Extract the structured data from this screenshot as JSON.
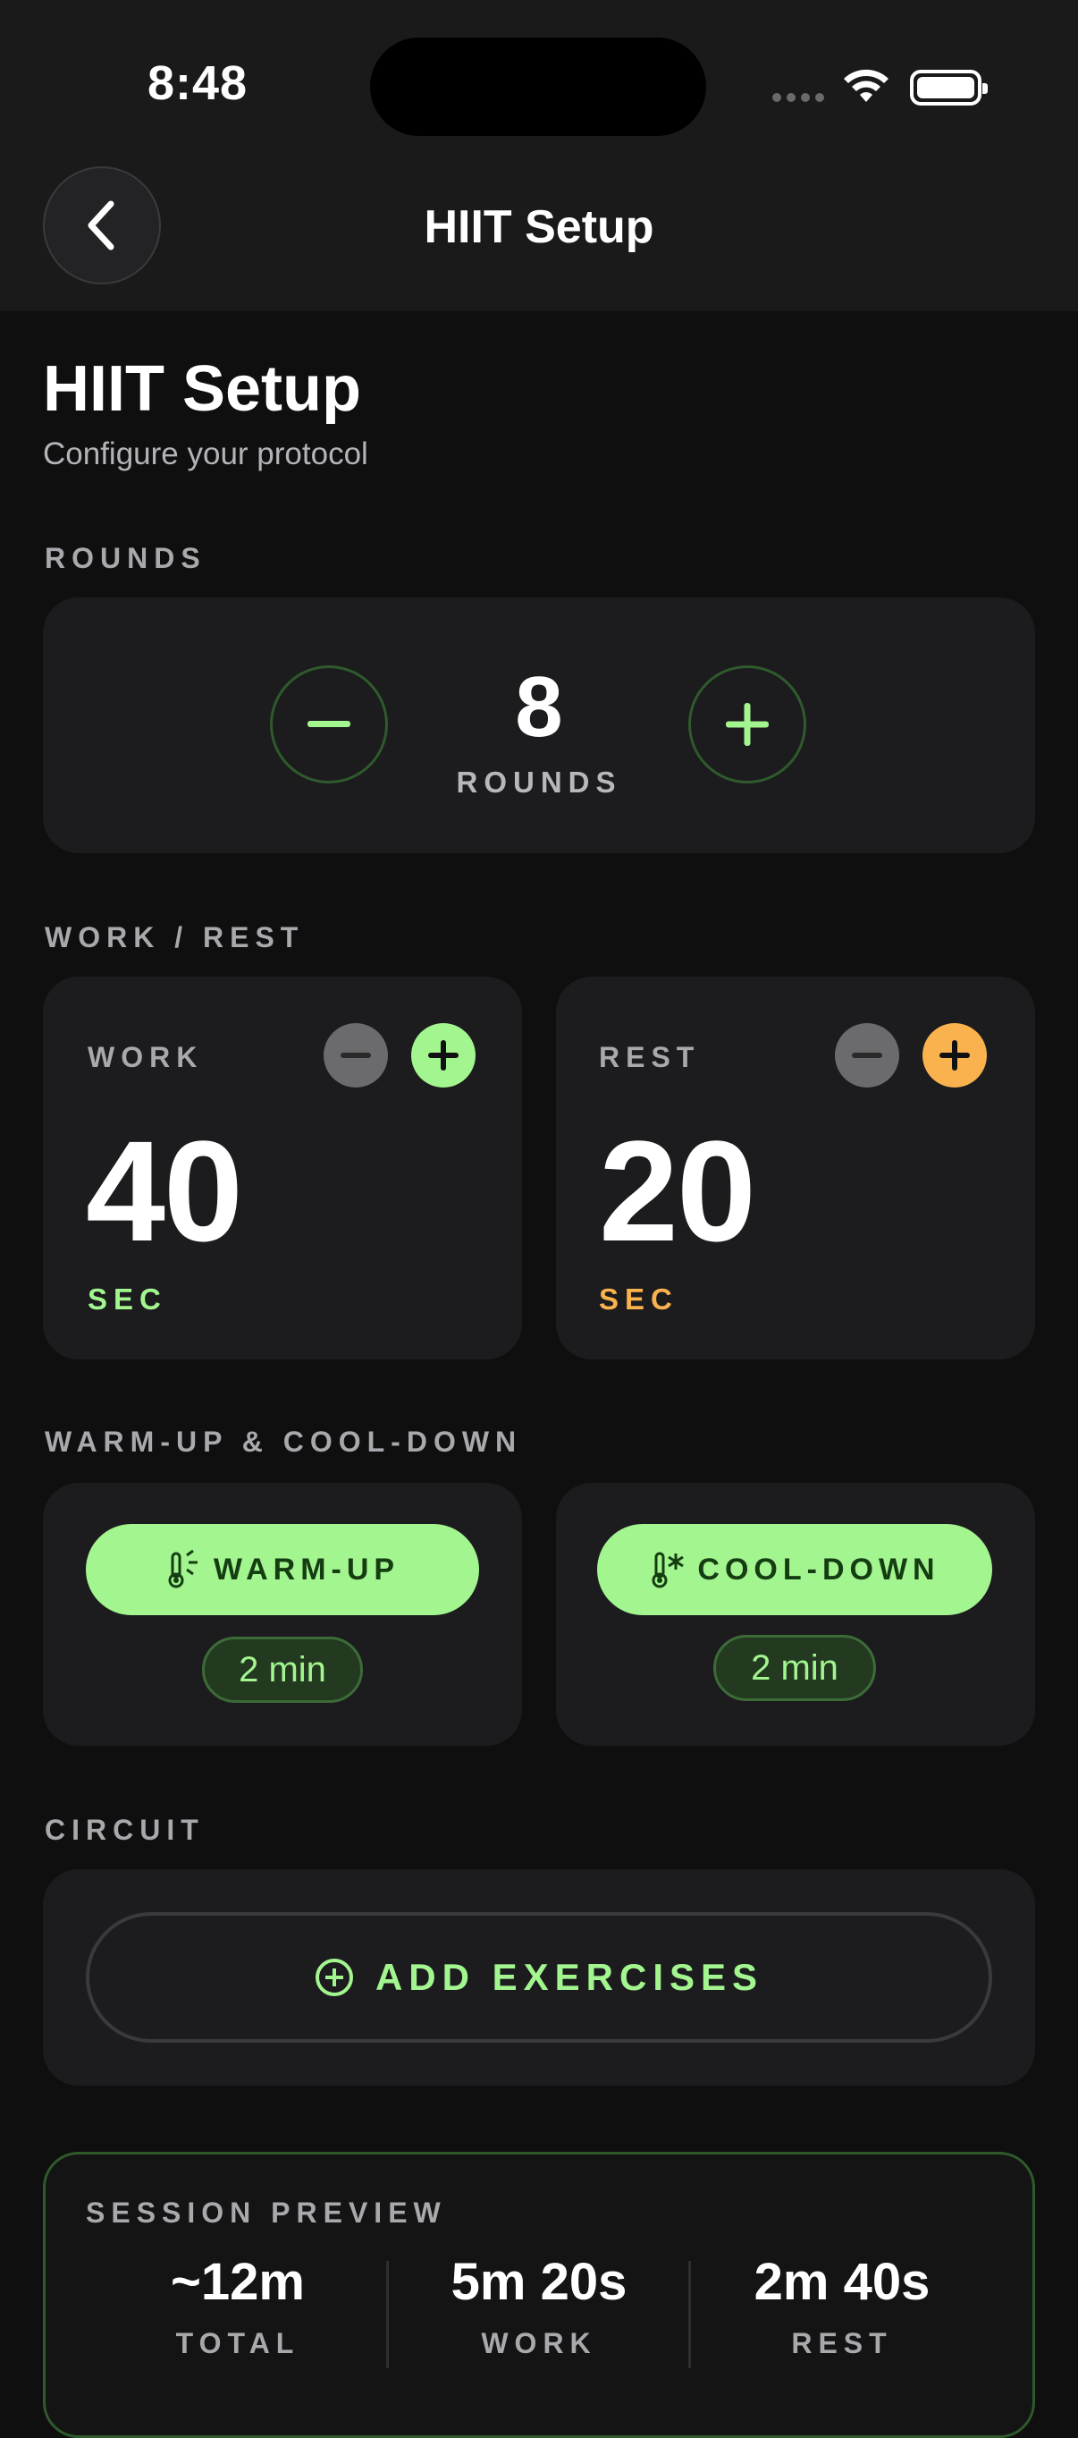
{
  "status": {
    "time": "8:48"
  },
  "nav": {
    "title": "HIIT Setup"
  },
  "header": {
    "title": "HIIT Setup",
    "subtitle": "Configure your protocol"
  },
  "sections": {
    "rounds": "ROUNDS",
    "work_rest": "WORK / REST",
    "warm_cool": "WARM-UP & COOL-DOWN",
    "circuit": "CIRCUIT"
  },
  "rounds": {
    "value": "8",
    "unit": "ROUNDS"
  },
  "work": {
    "label": "WORK",
    "value": "40",
    "unit": "SEC",
    "accent": "#a3f58f"
  },
  "rest": {
    "label": "REST",
    "value": "20",
    "unit": "SEC",
    "accent": "#f9b24e"
  },
  "warmup": {
    "label": "WARM-UP",
    "duration": "2 min"
  },
  "cooldown": {
    "label": "COOL-DOWN",
    "duration": "2 min"
  },
  "circuit": {
    "add_label": "ADD EXERCISES"
  },
  "preview": {
    "title": "SESSION PREVIEW",
    "stats": [
      {
        "value": "~12m",
        "label": "TOTAL"
      },
      {
        "value": "5m 20s",
        "label": "WORK"
      },
      {
        "value": "2m 40s",
        "label": "REST"
      }
    ]
  },
  "colors": {
    "accent_green": "#a3f58f",
    "accent_orange": "#f9b24e",
    "background": "#0f0f10",
    "card": "#1c1c1e"
  }
}
